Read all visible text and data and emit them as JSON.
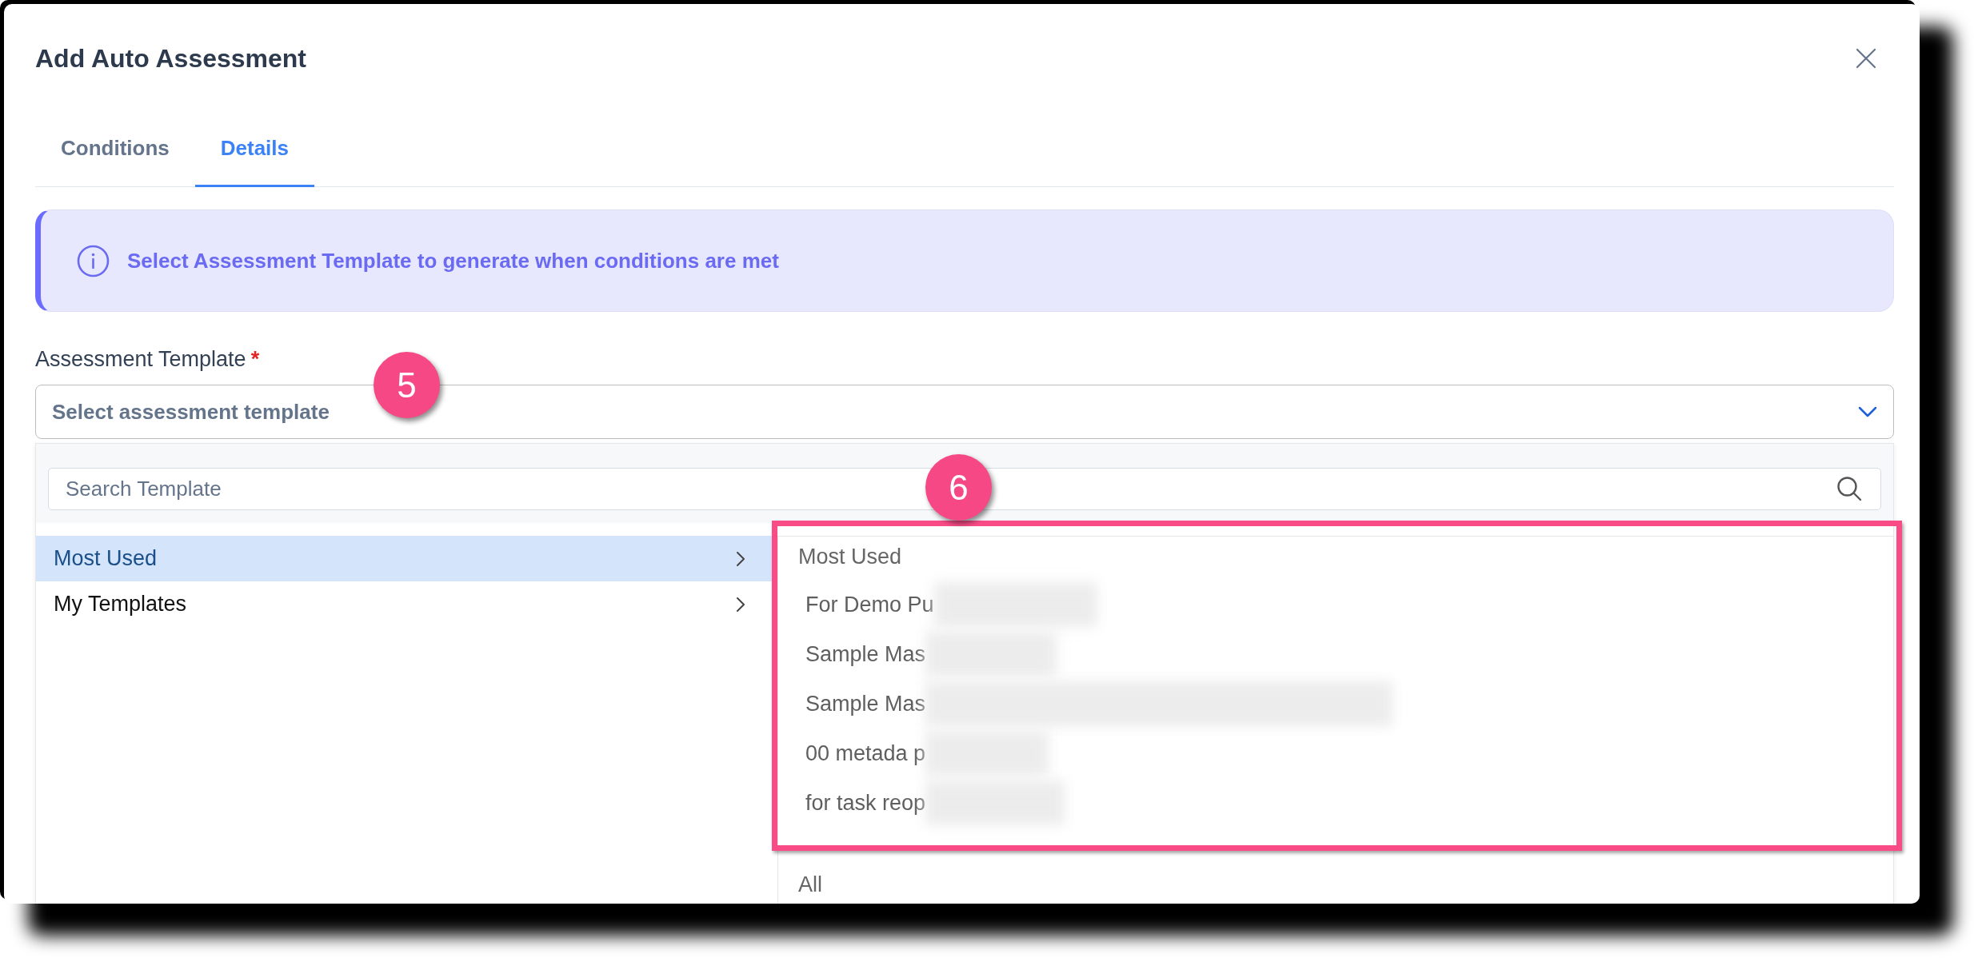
{
  "dialog": {
    "title": "Add Auto Assessment"
  },
  "tabs": [
    {
      "label": "Conditions",
      "selected": false
    },
    {
      "label": "Details",
      "selected": true
    }
  ],
  "info_banner": {
    "text": "Select Assessment Template to generate when conditions are met"
  },
  "template_field": {
    "label": "Assessment Template",
    "required_mark": "*",
    "placeholder": "Select assessment template",
    "expanded": true,
    "callout": "5"
  },
  "dropdown": {
    "search": {
      "placeholder": "Search Template"
    },
    "categories": [
      {
        "label": "Most Used",
        "selected": true
      },
      {
        "label": "My Templates",
        "selected": false
      }
    ],
    "groups": [
      {
        "heading": "Most Used",
        "highlighted": true,
        "callout": "6",
        "items": [
          {
            "text": "For Demo Pu",
            "redacted": true
          },
          {
            "text": "Sample Mas",
            "redacted": true
          },
          {
            "text": "Sample Mas",
            "redacted": true
          },
          {
            "text": "00 metada p",
            "redacted": true
          },
          {
            "text": "for task reop",
            "redacted": true
          }
        ]
      },
      {
        "heading": "All",
        "highlighted": false
      }
    ]
  }
}
